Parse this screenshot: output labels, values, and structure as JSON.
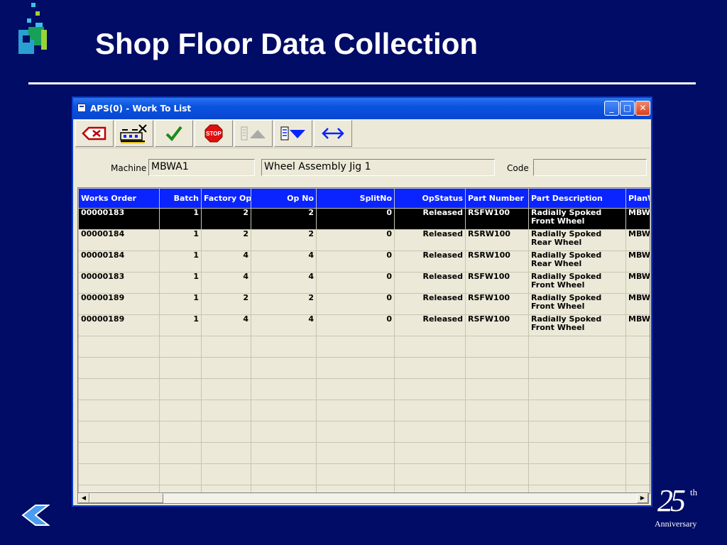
{
  "slide": {
    "title": "Shop Floor Data Collection",
    "anniversary": {
      "number": "25",
      "suffix": "th",
      "label": "Anniversary"
    },
    "colors": {
      "background": "#000c66",
      "rule": "#ffffff",
      "grid_header": "#0a24ff"
    }
  },
  "window": {
    "title": "APS(0) - Work To List",
    "controls": {
      "minimize": "_",
      "maximize": "□",
      "close": "✕"
    }
  },
  "toolbar": {
    "buttons": [
      {
        "name": "delete-icon"
      },
      {
        "name": "machine-tools-icon"
      },
      {
        "name": "check-icon"
      },
      {
        "name": "stop-icon",
        "text": "STOP"
      },
      {
        "name": "sort-up-icon"
      },
      {
        "name": "sort-down-icon"
      },
      {
        "name": "swap-icon"
      }
    ]
  },
  "fields": {
    "machine_label": "Machine",
    "machine_value": "MBWA1",
    "machine_desc": "Wheel Assembly Jig 1",
    "code_label": "Code",
    "code_value": ""
  },
  "grid": {
    "columns": [
      "Works Order",
      "Batch",
      "Factory Op",
      "Op No",
      "SplitNo",
      "OpStatus",
      "Part Number",
      "Part Description",
      "PlanW"
    ],
    "rows": [
      [
        "00000183",
        "1",
        "2",
        "2",
        "0",
        "Released",
        "RSFW100",
        "Radially Spoked Front Wheel",
        "MBW"
      ],
      [
        "00000184",
        "1",
        "2",
        "2",
        "0",
        "Released",
        "RSRW100",
        "Radially Spoked Rear Wheel",
        "MBW"
      ],
      [
        "00000184",
        "1",
        "4",
        "4",
        "0",
        "Released",
        "RSRW100",
        "Radially Spoked Rear Wheel",
        "MBW"
      ],
      [
        "00000183",
        "1",
        "4",
        "4",
        "0",
        "Released",
        "RSFW100",
        "Radially Spoked Front Wheel",
        "MBW"
      ],
      [
        "00000189",
        "1",
        "2",
        "2",
        "0",
        "Released",
        "RSFW100",
        "Radially Spoked Front Wheel",
        "MBW"
      ],
      [
        "00000189",
        "1",
        "4",
        "4",
        "0",
        "Released",
        "RSFW100",
        "Radially Spoked Front Wheel",
        "MBW"
      ]
    ],
    "selected_row": 0,
    "empty_rows": 8
  }
}
